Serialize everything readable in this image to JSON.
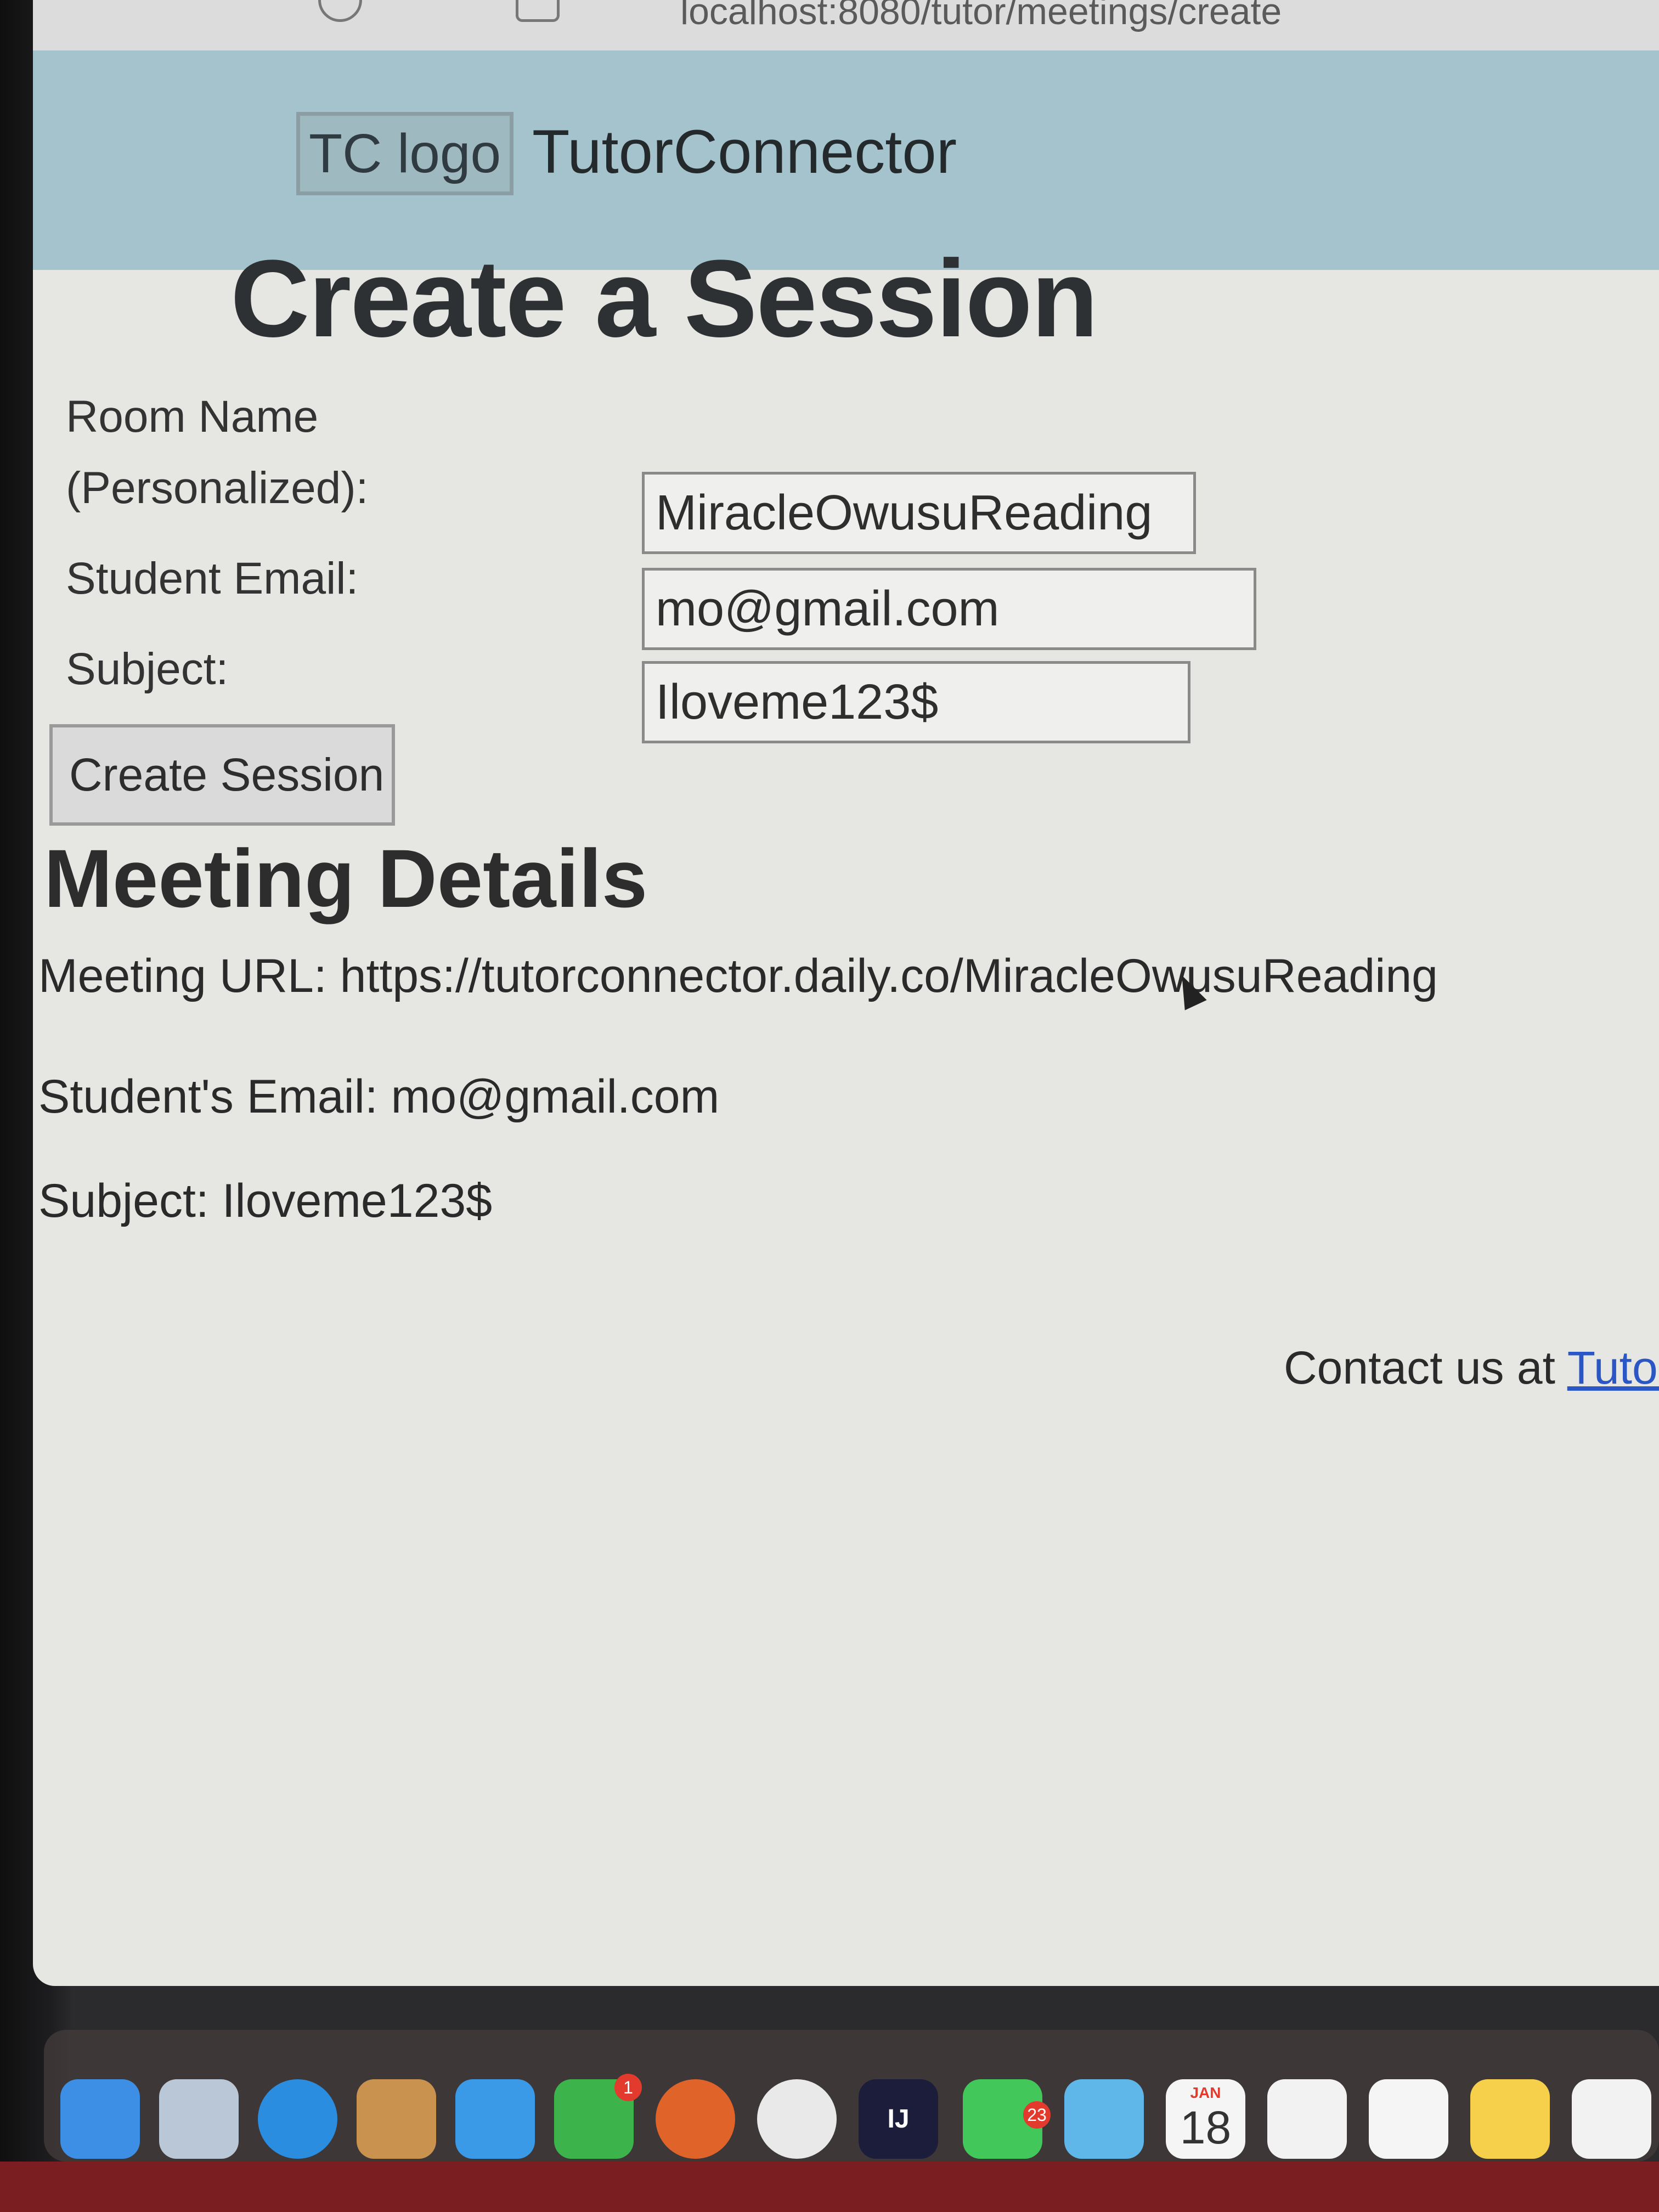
{
  "browser": {
    "url": "localhost:8080/tutor/meetings/create"
  },
  "header": {
    "logo_alt": "TC logo",
    "brand": "TutorConnector"
  },
  "page": {
    "title": "Create a Session"
  },
  "form": {
    "room_label_line1": "Room Name",
    "room_label_line2": "(Personalized):",
    "room_value": "MiracleOwusuReading",
    "email_label": "Student Email:",
    "email_value": "mo@gmail.com",
    "subject_label": "Subject:",
    "subject_value": "Iloveme123$",
    "submit_label": "Create Session"
  },
  "details": {
    "heading": "Meeting Details",
    "url_line": "Meeting URL: https://tutorconnector.daily.co/MiracleOwusuReading",
    "email_line": "Student's Email: mo@gmail.com",
    "subject_line": "Subject: Iloveme123$"
  },
  "footer": {
    "contact_prefix": "Contact us at ",
    "contact_link": "Tutor"
  },
  "dock": {
    "intellij_label": "IJ",
    "facetime_badge": "1",
    "messages_badge": "23",
    "calendar_month": "JAN",
    "calendar_day": "18",
    "colors": {
      "finder": "#3d8fe6",
      "launchpad": "#b9c7d6",
      "safari": "#2a8de0",
      "contacts": "#c9924e",
      "mail": "#3a9ae8",
      "facetime": "#3cb44b",
      "firefox": "#e0632a",
      "chrome": "#e9e9e9",
      "intellij": "#1b1d3a",
      "messages": "#42c85a",
      "maps": "#5fb6e8",
      "calendar": "#f5f5f5",
      "photos": "#f2f2f2",
      "reminders": "#f5f5f5",
      "notes": "#f6d04a",
      "freeform": "#f2f2f2"
    }
  }
}
